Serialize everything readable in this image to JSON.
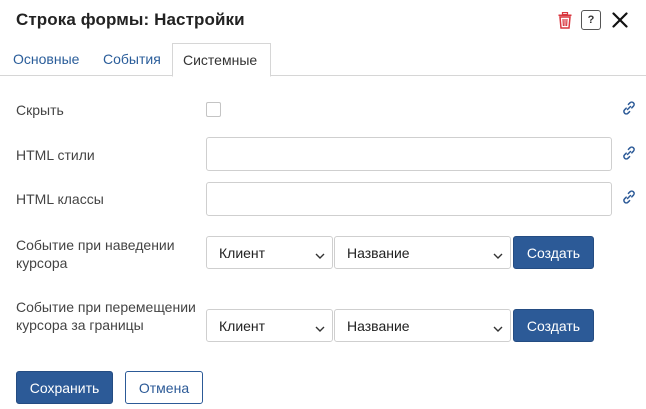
{
  "dialog": {
    "title": "Строка формы: Настройки",
    "icons": {
      "delete": "trash-icon",
      "help": "?",
      "close": "close-icon"
    },
    "colors": {
      "accent": "#2c5a97",
      "danger": "#d9363e",
      "link_icon": "#2c5a97"
    }
  },
  "tabs": [
    {
      "label": "Основные",
      "active": false
    },
    {
      "label": "События",
      "active": false
    },
    {
      "label": "Системные",
      "active": true
    }
  ],
  "fields": {
    "hide": {
      "label": "Скрыть",
      "checked": false
    },
    "html_styles": {
      "label": "HTML стили",
      "value": ""
    },
    "html_classes": {
      "label": "HTML классы",
      "value": ""
    },
    "hover_event": {
      "label": "Событие при наведении курсора",
      "side": "Клиент",
      "name": "Название",
      "create_label": "Создать"
    },
    "leave_event": {
      "label": "Событие при перемещении курсора за границы",
      "side": "Клиент",
      "name": "Название",
      "create_label": "Создать"
    }
  },
  "footer": {
    "save_label": "Сохранить",
    "cancel_label": "Отмена"
  }
}
